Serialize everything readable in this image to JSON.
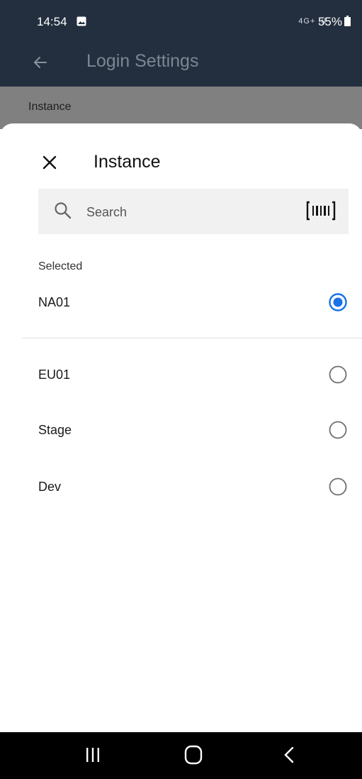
{
  "status_bar": {
    "time": "14:54",
    "signal": "4G+ .ıl",
    "battery": "55%"
  },
  "app_bar": {
    "title": "Login Settings"
  },
  "section": {
    "label": "Instance"
  },
  "sheet": {
    "title": "Instance",
    "search": {
      "placeholder": "Search",
      "value": ""
    },
    "group_label": "Selected",
    "options": [
      {
        "label": "NA01",
        "selected": true
      },
      {
        "label": "EU01",
        "selected": false
      },
      {
        "label": "Stage",
        "selected": false
      },
      {
        "label": "Dev",
        "selected": false
      }
    ]
  },
  "colors": {
    "header_bg": "#232f3e",
    "radio_selected": "#1a73e8",
    "radio_unselected": "#6f6f6f"
  },
  "icons": {
    "back": "arrow-left-icon",
    "close": "close-icon",
    "search": "search-icon",
    "scanner": "barcode-scan-icon",
    "nav_recent": "recent-apps-icon",
    "nav_home": "home-icon",
    "nav_back": "chevron-left-icon"
  }
}
